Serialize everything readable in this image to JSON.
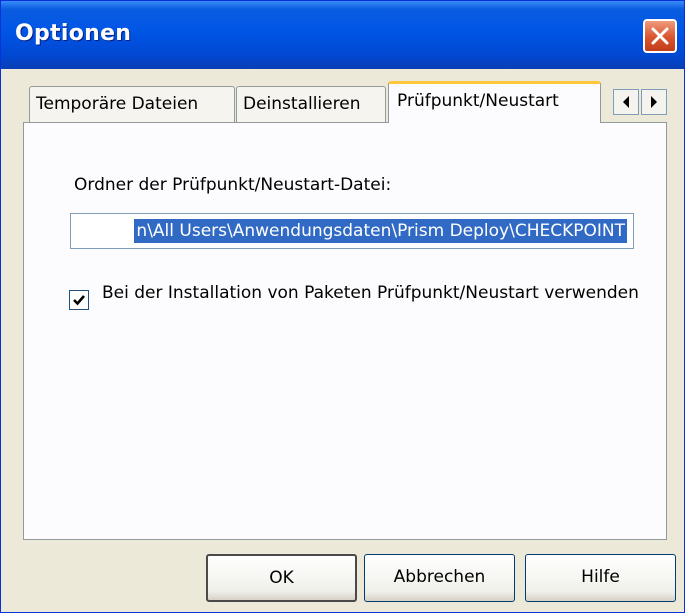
{
  "window": {
    "title": "Optionen"
  },
  "tabs": [
    {
      "label": "Temporäre Dateien"
    },
    {
      "label": "Deinstallieren"
    },
    {
      "label": "Prüfpunkt/Neustart"
    }
  ],
  "panel": {
    "folder_label": "Ordner der Prüfpunkt/Neustart-Datei:",
    "folder_value": "n\\All Users\\Anwendungsdaten\\Prism Deploy\\CHECKPOINT",
    "checkbox_checked": true,
    "checkbox_label": "Bei der Installation von Paketen Prüfpunkt/Neustart verwenden"
  },
  "buttons": {
    "ok": "OK",
    "cancel": "Abbrechen",
    "help": "Hilfe"
  },
  "colors": {
    "title_bar": "#0055E5",
    "selection": "#316AC5",
    "close": "#D9552F",
    "active_tab_highlight": "#FFC83C"
  }
}
